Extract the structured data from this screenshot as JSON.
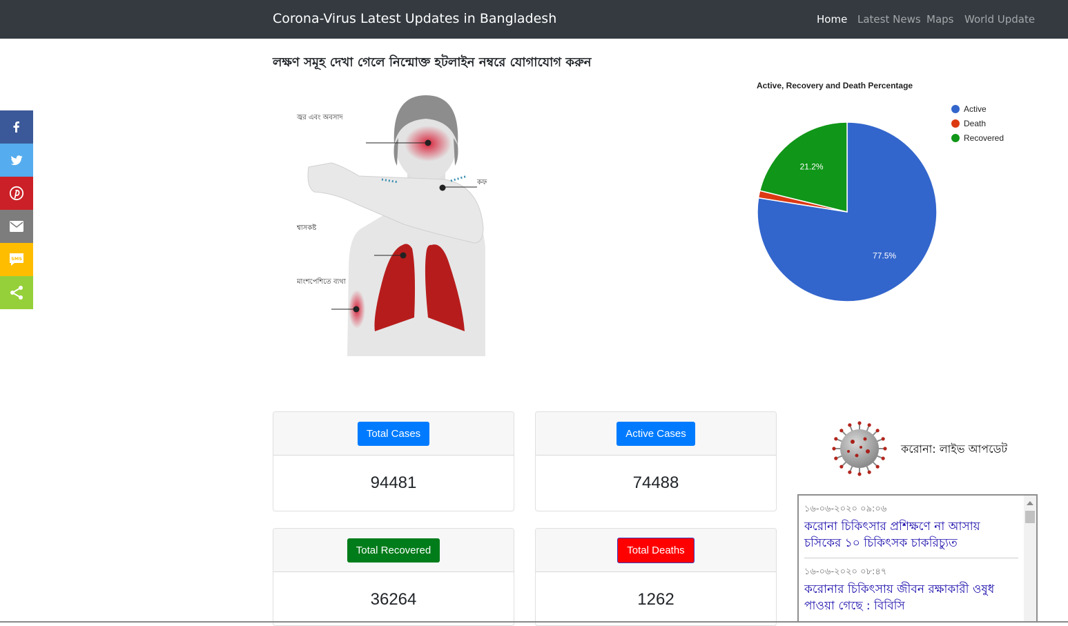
{
  "navbar": {
    "brand": "Corona-Virus Latest Updates in Bangladesh",
    "links": [
      {
        "label": "Home",
        "active": true
      },
      {
        "label": "Latest News",
        "active": false
      },
      {
        "label": "Maps",
        "active": false
      },
      {
        "label": "World Update",
        "active": false
      }
    ]
  },
  "heading": "লক্ষণ সমূহ দেখা গেলে নিন্মোক্ত হটলাইন নম্বরে যোগাযোগ করুন",
  "share_bar": [
    {
      "icon": "facebook-icon",
      "color": "#3b5998"
    },
    {
      "icon": "twitter-icon",
      "color": "#55acee"
    },
    {
      "icon": "pinterest-icon",
      "color": "#cb2027"
    },
    {
      "icon": "email-icon",
      "color": "#7d7d7d"
    },
    {
      "icon": "sms-icon",
      "color": "#ffbd00"
    },
    {
      "icon": "share-icon",
      "color": "#95d03a"
    }
  ],
  "illustration": {
    "labels": {
      "fever": "জ্বর এবং অবসাদ",
      "cough": "কফ",
      "breath": "শ্বাসকষ্ট",
      "muscle": "মাংশপেশিতে ব্যথা"
    }
  },
  "chart_data": {
    "type": "pie",
    "title": "Active, Recovery and Death Percentage",
    "categories": [
      "Active",
      "Death",
      "Recovered"
    ],
    "values": [
      77.5,
      1.3,
      21.2
    ],
    "colors": [
      "#3366cc",
      "#dc3912",
      "#109618"
    ],
    "data_labels": [
      "77.5%",
      "",
      "21.2%"
    ],
    "legend_position": "right"
  },
  "stats": {
    "total_cases": {
      "label": "Total Cases",
      "value": "94481",
      "color": "#007bff"
    },
    "active_cases": {
      "label": "Active Cases",
      "value": "74488",
      "color": "#007bff"
    },
    "total_recovered": {
      "label": "Total Recovered",
      "value": "36264",
      "color": "#007c1a"
    },
    "total_deaths": {
      "label": "Total Deaths",
      "value": "1262",
      "color": "#ff0000"
    }
  },
  "live_update": {
    "title": "করোনা: লাইভ আপডেট",
    "news": [
      {
        "time": "১৬-০৬-২০২০ ০৯:০৬",
        "headline": "করোনা চিকিৎসার প্রশিক্ষণে না আসায় চসিকের ১০ চিকিৎসক চাকরিচ্যুত"
      },
      {
        "time": "১৬-০৬-২০২০ ০৮:৪৭",
        "headline": "করোনার চিকিৎসায় জীবন রক্ষাকারী ওষুধ পাওয়া গেছে : বিবিসি"
      }
    ]
  }
}
